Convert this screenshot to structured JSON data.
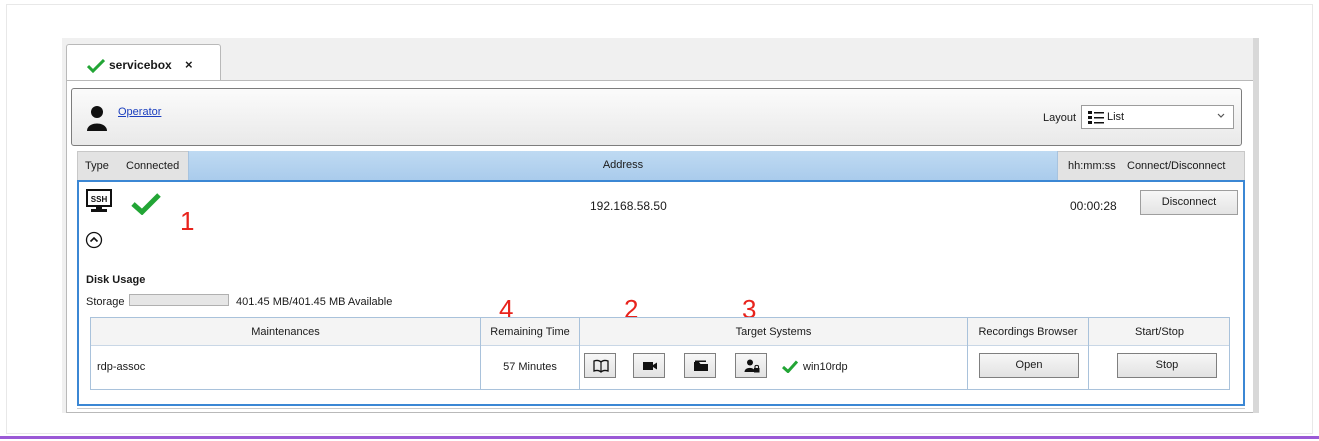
{
  "tab": {
    "label": "servicebox",
    "close": "×"
  },
  "operator": {
    "name": "Operator"
  },
  "layout": {
    "label": "Layout",
    "value": "List"
  },
  "table_header": {
    "type": "Type",
    "connected": "Connected",
    "address": "Address",
    "time": "hh:mm:ss",
    "connect": "Connect/Disconnect"
  },
  "session": {
    "protocol": "SSH",
    "address": "192.168.58.50",
    "elapsed": "00:00:28",
    "disconnect_label": "Disconnect",
    "disk_usage_title": "Disk Usage",
    "storage_label": "Storage",
    "storage_text": "401.45 MB/401.45 MB Available",
    "storage_fill_fraction": 1.0
  },
  "maintenance_table": {
    "headers": [
      "Maintenances",
      "Remaining Time",
      "Target Systems",
      "Recordings Browser",
      "Start/Stop"
    ],
    "rows": [
      {
        "name": "rdp-assoc",
        "remaining": "57 Minutes",
        "target": "win10rdp",
        "recordings_label": "Open",
        "action_label": "Stop"
      }
    ]
  },
  "annotations": [
    "1",
    "2",
    "3",
    "4"
  ],
  "colors": {
    "accent_blue": "#3b87d4",
    "check_green": "#22a535",
    "annotation_red": "#e8231c",
    "link_blue": "#1b3fbf",
    "bottom_accent": "#9b59d6"
  },
  "icons": {
    "tab_status": "check-icon",
    "operator": "user-icon",
    "layout": "list-icon",
    "protocol": "monitor-icon",
    "collapse": "chevron-up-circle-icon",
    "target_buttons": [
      "book-icon",
      "video-camera-icon",
      "folder-icon",
      "user-lock-icon"
    ]
  }
}
